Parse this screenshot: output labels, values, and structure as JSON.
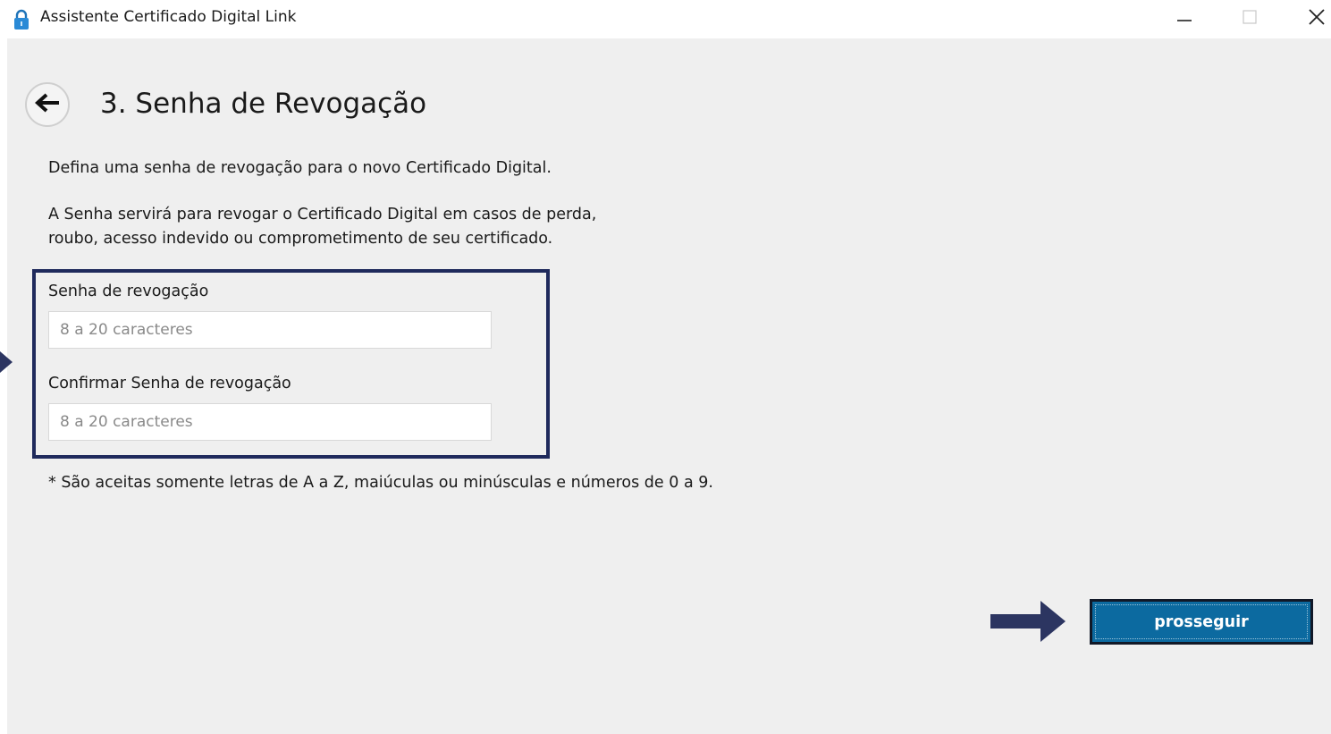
{
  "window": {
    "title": "Assistente Certificado Digital Link",
    "icons": {
      "app": "lock-icon",
      "minimize": "minimize-icon",
      "maximize": "maximize-icon",
      "close": "close-icon"
    }
  },
  "page": {
    "title": "3. Senha de Revogação",
    "back_icon": "arrow-left-icon",
    "description": "Defina uma senha de revogação para o novo Certificado Digital.",
    "info_line1": "A Senha servirá para revogar o Certificado Digital em casos de perda,",
    "info_line2": "roubo, acesso indevido ou comprometimento de seu certificado.",
    "note": "* São aceitas somente letras de A a Z, maiúculas ou minúsculas e números de 0 a 9."
  },
  "form": {
    "password": {
      "label": "Senha de revogação",
      "placeholder": "8 a 20 caracteres",
      "value": ""
    },
    "confirm": {
      "label": "Confirmar Senha de revogação",
      "placeholder": "8 a 20 caracteres",
      "value": ""
    }
  },
  "actions": {
    "proceed_label": "prosseguir"
  },
  "colors": {
    "highlight": "#1f2a5c",
    "button": "#0c6aa0",
    "background": "#efefef"
  }
}
